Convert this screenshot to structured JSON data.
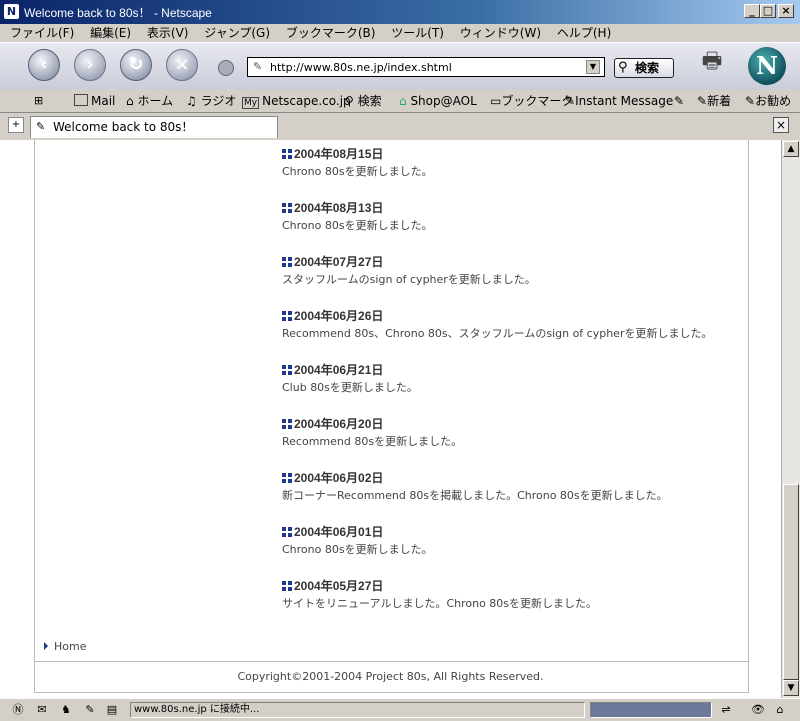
{
  "window": {
    "title": "Welcome back to 80s！ - Netscape"
  },
  "menu": [
    "ファイル(F)",
    "編集(E)",
    "表示(V)",
    "ジャンプ(G)",
    "ブックマーク(B)",
    "ツール(T)",
    "ウィンドウ(W)",
    "ヘルプ(H)"
  ],
  "navbar": {
    "url": "http://www.80s.ne.jp/index.shtml",
    "search_label": "検索"
  },
  "personal_toolbar": [
    "Mail",
    "ホーム",
    "ラジオ",
    "Netscape.co.jp",
    "検索",
    "Shop@AOL",
    "ブックマーク",
    "Instant Message",
    "新着",
    "お勧め"
  ],
  "tab": {
    "label": "Welcome back to 80s！"
  },
  "news": [
    {
      "date": "2004年08月15日",
      "text": "Chrono 80sを更新しました。"
    },
    {
      "date": "2004年08月13日",
      "text": "Chrono 80sを更新しました。"
    },
    {
      "date": "2004年07月27日",
      "text": "スタッフルームのsign of cypherを更新しました。"
    },
    {
      "date": "2004年06月26日",
      "text": "Recommend 80s、Chrono 80s、スタッフルームのsign of cypherを更新しました。"
    },
    {
      "date": "2004年06月21日",
      "text": "Club 80sを更新しました。"
    },
    {
      "date": "2004年06月20日",
      "text": "Recommend 80sを更新しました。"
    },
    {
      "date": "2004年06月02日",
      "text": "新コーナーRecommend 80sを掲載しました。Chrono 80sを更新しました。"
    },
    {
      "date": "2004年06月01日",
      "text": "Chrono 80sを更新しました。"
    },
    {
      "date": "2004年05月27日",
      "text": "サイトをリニューアルしました。Chrono 80sを更新しました。"
    }
  ],
  "footer": {
    "home_link": "Home",
    "copyright": "Copyright©2001-2004 Project 80s, All Rights Reserved."
  },
  "status": {
    "text": "www.80s.ne.jp に接続中..."
  }
}
